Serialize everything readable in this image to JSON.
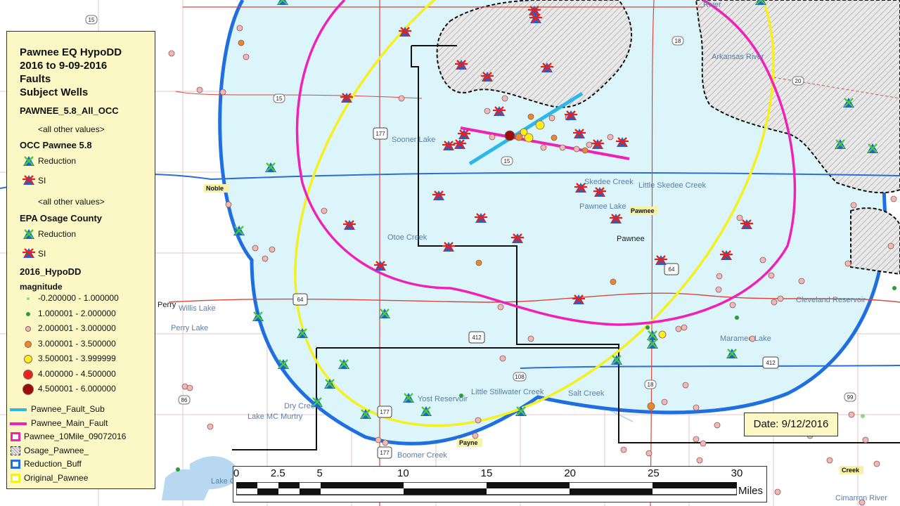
{
  "legend": {
    "title_lines": [
      "Pawnee EQ HypoDD",
      "2016 to 9-09-2016",
      "Faults",
      "Subject Wells"
    ],
    "pawnee_layer": "PAWNEE_5.8_All_OCC",
    "all_other_1": "<all other values>",
    "occ_group": "OCC Pawnee 5.8",
    "occ_reduction": "Reduction",
    "occ_si": "SI",
    "all_other_2": "<all other values>",
    "epa_group": "EPA Osage County",
    "epa_reduction": "Reduction",
    "epa_si": "SI",
    "hypodd_group": "2016_HypoDD",
    "magnitude_label": "magnitude",
    "magnitude_classes": [
      {
        "label": "-0.200000 - 1.000000",
        "color": "#8fd87a"
      },
      {
        "label": "1.000001 - 2.000000",
        "color": "#2a9a3a"
      },
      {
        "label": "2.000001 - 3.000000",
        "color": "#f2b8b4"
      },
      {
        "label": "3.000001 - 3.500000",
        "color": "#e98a2a"
      },
      {
        "label": "3.500001 - 3.999999",
        "color": "#ffee1a"
      },
      {
        "label": "4.000000 - 4.500000",
        "color": "#e8241d"
      },
      {
        "label": "4.500001 - 6.000000",
        "color": "#9b0c0c"
      }
    ],
    "layers": [
      {
        "label": "Pawnee_Fault_Sub",
        "color": "#2bb8e8"
      },
      {
        "label": "Pawnee_Main_Fault",
        "color": "#ee22b8"
      },
      {
        "label": "Pawnee_10Mile_09072016",
        "color": "#ee22b8"
      },
      {
        "label": "Osage_Pawnee_",
        "color": "#999999"
      },
      {
        "label": "Reduction_Buff",
        "color": "#1f6fe0"
      },
      {
        "label": "Original_Pawnee",
        "color": "#f5f01f"
      }
    ]
  },
  "date_box": "Date: 9/12/2016",
  "scale_bar": {
    "ticks": [
      "0",
      "2.5",
      "5",
      "10",
      "15",
      "20",
      "25",
      "30"
    ],
    "units": "Miles"
  },
  "places": {
    "sooner_lake": "Sooner Lake",
    "skedee_creek": "Skedee Creek",
    "little_skedee_creek": "Little Skedee Creek",
    "pawnee_lake": "Pawnee Lake",
    "pawnee_hl": "Pawnee",
    "pawnee": "Pawnee",
    "otoe_creek": "Otoe Creek",
    "noble": "Noble",
    "perry_lake": "Perry Lake",
    "perry": "Perry",
    "willis_lake": "Willis Lake",
    "arkansas_river": "Arkansas River",
    "river_top": "River",
    "cleveland_reservoir": "Cleveland Reservoir",
    "maramec_lake": "Maramec Lake",
    "salt_creek": "Salt Creek",
    "little_stillwater_creek": "Little Stillwater Creek",
    "yost_reservoir": "Yost Reservoir",
    "dry_creek": "Dry Creek",
    "lake_mc_murtry": "Lake MC Murtry",
    "boomer_creek": "Boomer Creek",
    "payne": "Payne",
    "creek": "Creek",
    "cimarron_river": "Cimarron River",
    "lake_partial": "Lake C"
  },
  "shields": [
    "15",
    "15",
    "15",
    "177",
    "177",
    "177",
    "64",
    "64",
    "412",
    "412",
    "18",
    "18",
    "20",
    "108",
    "86",
    "99"
  ]
}
